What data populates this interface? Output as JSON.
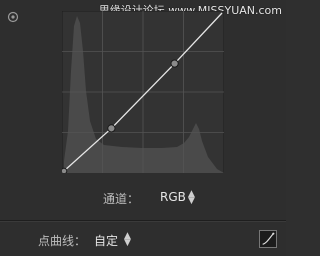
{
  "watermark": "思缘设计论坛 www.MISSYUAN.com",
  "channel": {
    "label": "通道：",
    "value": "RGB"
  },
  "point_curve": {
    "label": "点曲线：",
    "value": "自定"
  },
  "curve": {
    "control_points": [
      {
        "in": 0,
        "out": 0
      },
      {
        "in": 30,
        "out": 27
      },
      {
        "in": 70,
        "out": 68
      },
      {
        "in": 100,
        "out": 100
      }
    ]
  },
  "colors": {
    "background": "#2e2e2e",
    "curve": "#e6e6e6",
    "histogram": "#4d4d4d",
    "grid": "#5a5a5a"
  },
  "icons": {
    "target": "target-adjustment-icon",
    "curve_type": "curve-icon"
  }
}
